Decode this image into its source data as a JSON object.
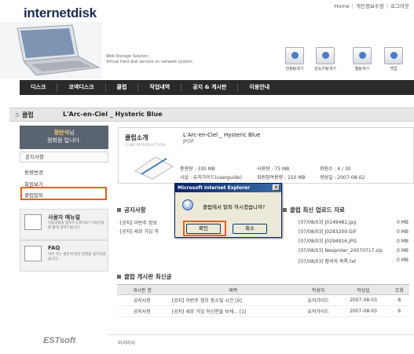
{
  "header": {
    "logo": "internetdisk",
    "top_links": [
      "Home",
      "개인정보수정",
      "로그아웃"
    ],
    "tagline_1": "Web Storage Solution",
    "tagline_2": "Virtual hard disk service on network system",
    "tools": [
      {
        "label": "전용탐색기",
        "icon": "explorer-icon"
      },
      {
        "label": "윈도우탐색기",
        "icon": "windows-explorer-icon"
      },
      {
        "label": "웹탐색기",
        "icon": "web-explorer-icon"
      },
      {
        "label": "백업",
        "icon": "backup-icon"
      }
    ]
  },
  "nav": [
    "디스크",
    "코넥디스크",
    "클럽",
    "작업내역",
    "공지 & 게시판",
    "이용안내"
  ],
  "club_bar": {
    "label": "클럽",
    "title": "L'Arc-en-Ciel _ Hysteric Blue"
  },
  "sidebar": {
    "user_name": "정만석",
    "user_suffix": "님",
    "user_role": "정회원 입니다.",
    "links": [
      "공지사항",
      "용량변경",
      "회원보기",
      "클럽탈퇴"
    ],
    "help": [
      {
        "title": "사용자 매뉴얼",
        "desc": "이용방법을 잘모르시겠어요? 이용안내를 통해 알려드립니다."
      },
      {
        "title": "FAQ",
        "desc": "자주 하는 질문에 대한 답변을 정리하였습니다."
      }
    ]
  },
  "intro": {
    "label": "클럽소개",
    "sublabel": "CLUB INTRODUCTION",
    "club_name": "L'Arc-en-Ciel _ Hysteric Blue",
    "category": "JPOP",
    "stats": {
      "total": "총용량 : 330 MB",
      "used": "사용량 : 75 MB",
      "members": "회원수 : 4 / 30",
      "owner": "시삽 : 유저가이드(userguide)",
      "limit": "회원참여용량 : 150 MB",
      "created": "생성일 : 2007-08-02"
    }
  },
  "notices": {
    "title": "공지사항",
    "items": [
      "[공지] 이번주 정보",
      "[공지] 새로 가입 하"
    ]
  },
  "uploads": {
    "title": "클럽 최신 업로드 자료",
    "items": [
      {
        "name": "[07/08/03] J0149481.jpg",
        "size": "0 MB"
      },
      {
        "name": "[07/08/03] J0283209.GIF",
        "size": "0 MB"
      },
      {
        "name": "[07/08/03] J0294916.JPG",
        "size": "0 MB"
      },
      {
        "name": "[07/08/03] Nexproler_20070717.zip",
        "size": "0 MB"
      },
      {
        "name": "[07/08/03] 참여자 목록.txt",
        "size": "0 MB"
      }
    ]
  },
  "board": {
    "title": "클럽 게시판 최신글",
    "headers": [
      "게시판 명",
      "제목",
      "작성자",
      "작성일",
      "조회"
    ],
    "rows": [
      [
        "공지사항",
        "[공지] 이번주 정모 장소및 시간 [0]",
        "유저가이드",
        "2007-08-03",
        "8"
      ],
      [
        "공지사항",
        "[공지] 새로 가입 하신분들 보세... [1]",
        "유저가이드",
        "2007-08-03",
        "6"
      ]
    ]
  },
  "footer": {
    "logo": "ESTsoft",
    "link": "머리머리"
  },
  "dialog": {
    "title": "Microsoft Internet Explorer",
    "message": "클럽에서 탈퇴 하시겠습니까?",
    "ok": "확인",
    "cancel": "취소",
    "close": "x"
  },
  "colors": {
    "highlight": "#e2631c",
    "nav_bg": "#2a2a2a",
    "titlebar": "#0a246a"
  }
}
